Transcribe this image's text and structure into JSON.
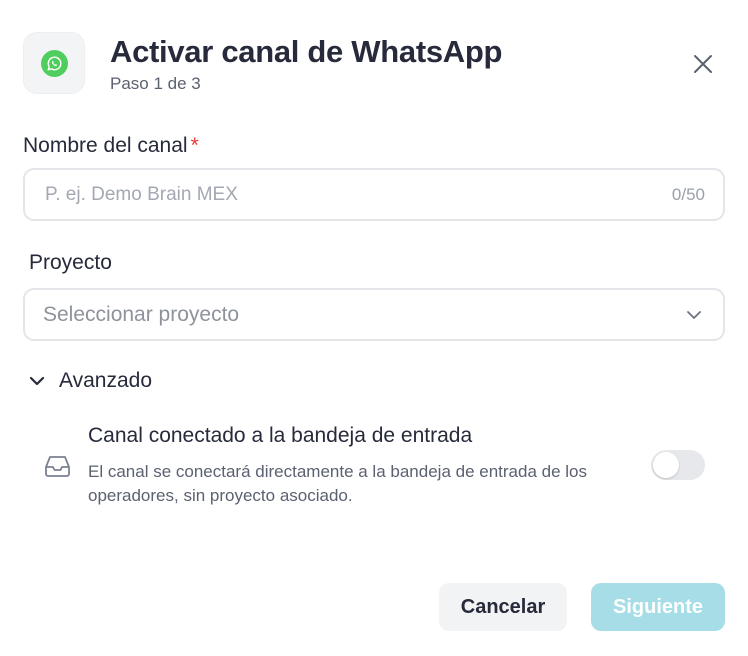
{
  "header": {
    "title": "Activar canal de WhatsApp",
    "step": "Paso 1 de 3",
    "icon": "whatsapp-icon",
    "brand_color": "#4fce5d"
  },
  "form": {
    "name_field": {
      "label": "Nombre del canal",
      "required_mark": "*",
      "placeholder": "P. ej. Demo Brain MEX",
      "value": "",
      "counter": "0/50"
    },
    "project_field": {
      "label": "Proyecto",
      "placeholder": "Seleccionar proyecto"
    }
  },
  "advanced": {
    "label": "Avanzado",
    "expanded": true,
    "option": {
      "icon": "inbox-icon",
      "title": "Canal conectado a la bandeja de entrada",
      "description": "El canal se conectará directamente a la bandeja de entrada de los operadores, sin proyecto asociado.",
      "enabled": false
    }
  },
  "footer": {
    "cancel_label": "Cancelar",
    "next_label": "Siguiente",
    "next_color": "#a6dde6"
  }
}
